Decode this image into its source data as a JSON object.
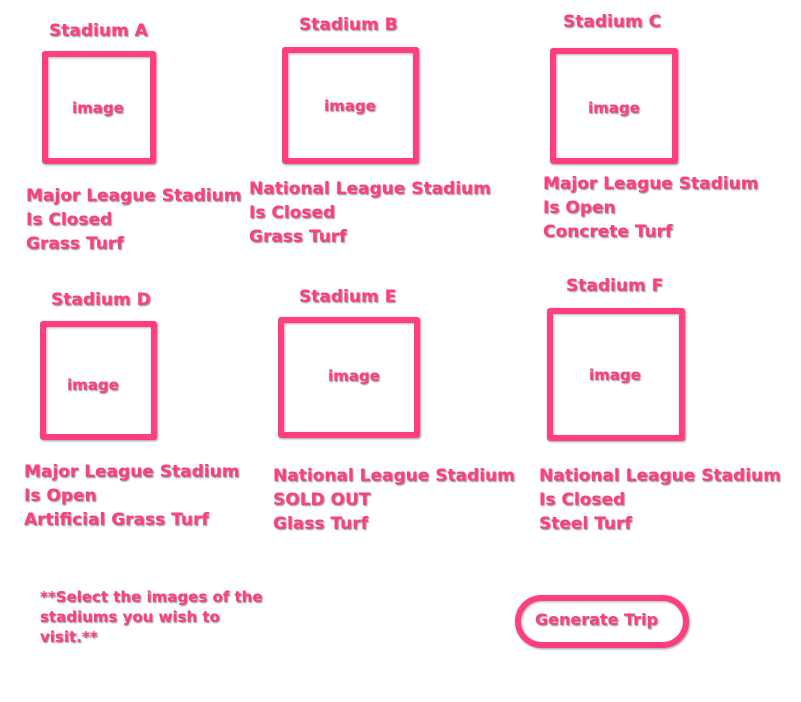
{
  "accent_color": "#ff3d7f",
  "stadiums": [
    {
      "title": "Stadium A",
      "image_label": "image",
      "league": "Major League Stadium",
      "status": "Is Closed",
      "turf": "Grass Turf"
    },
    {
      "title": "Stadium B",
      "image_label": "image",
      "league": "National League Stadium",
      "status": "Is Closed",
      "turf": "Grass Turf"
    },
    {
      "title": "Stadium C",
      "image_label": "image",
      "league": "Major League Stadium",
      "status": "Is Open",
      "turf": "Concrete Turf"
    },
    {
      "title": "Stadium D",
      "image_label": "image",
      "league": "Major League Stadium",
      "status": "Is Open",
      "turf": "Artificial Grass Turf"
    },
    {
      "title": "Stadium E",
      "image_label": "image",
      "league": "National League Stadium",
      "status": "SOLD OUT",
      "turf": "Glass Turf"
    },
    {
      "title": "Stadium F",
      "image_label": "image",
      "league": "National League Stadium",
      "status": "Is Closed",
      "turf": "Steel Turf"
    }
  ],
  "instructions": "**Select the images of the stadiums you wish to visit.**",
  "generate_button_label": "Generate Trip"
}
